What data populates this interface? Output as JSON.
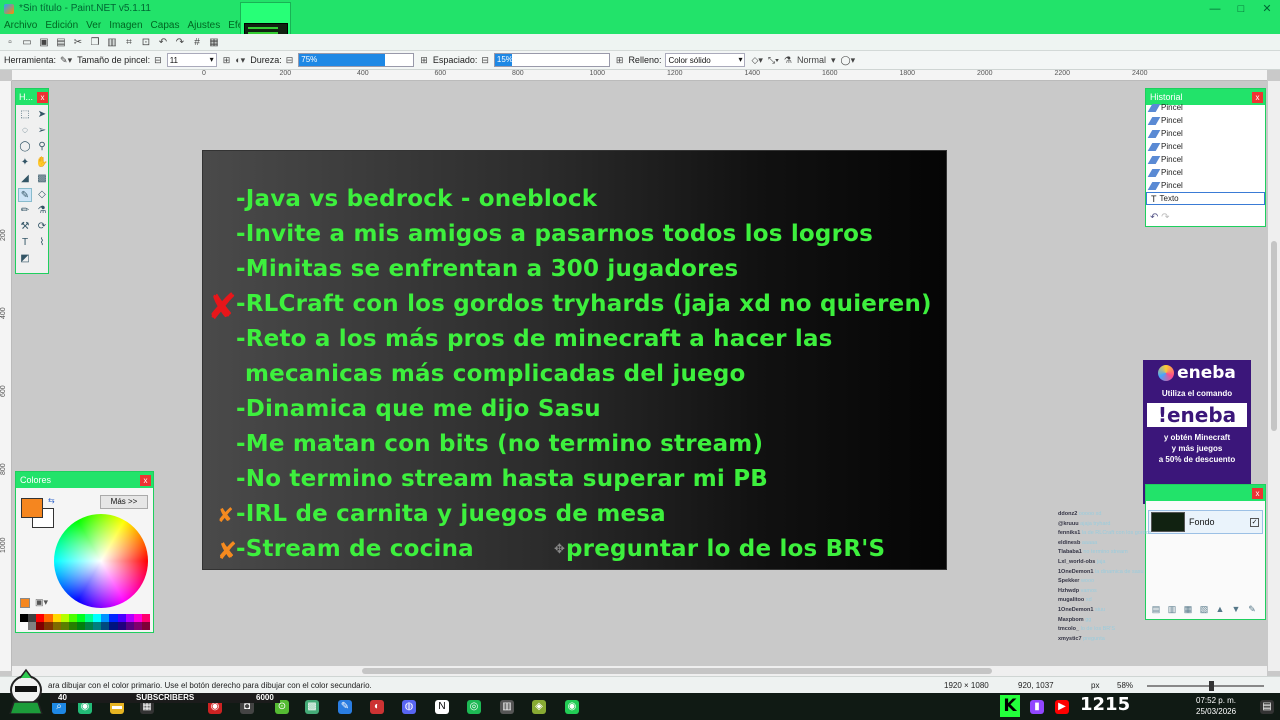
{
  "window": {
    "title": "*Sin título - Paint.NET v5.1.11",
    "controls": [
      "—",
      "□",
      "✕"
    ]
  },
  "menu": {
    "items": [
      "Archivo",
      "Edición",
      "Ver",
      "Imagen",
      "Capas",
      "Ajustes",
      "Efectos"
    ]
  },
  "toolbar": {
    "tool_label": "Herramienta:",
    "brush_size_label": "Tamaño de pincel:",
    "brush_size_value": "11",
    "hardness_label": "Dureza:",
    "hardness_value": "75%",
    "hardness_fraction": 0.75,
    "spacing_label": "Espaciado:",
    "spacing_value": "15%",
    "spacing_fraction": 0.15,
    "fill_label": "Relleno:",
    "fill_value": "Color sólido",
    "blend_mode": "Normal"
  },
  "rulers": {
    "top": [
      "0",
      "200",
      "400",
      "600",
      "800",
      "1000",
      "1200",
      "1400",
      "1600",
      "1800",
      "2000",
      "2200",
      "2400"
    ],
    "left": [
      "200",
      "400",
      "600",
      "800",
      "1000"
    ]
  },
  "canvas": {
    "text_color": "#3df03d",
    "lines": [
      "-Java vs bedrock - oneblock",
      "-Invite a mis amigos a pasarnos todos los logros",
      "-Minitas se enfrentan a 300 jugadores",
      "-RLCraft con los gordos tryhards (jaja xd no quieren)",
      "-Reto a los más pros de minecraft a hacer las",
      "mecanicas más complicadas del juego",
      "-Dinamica que me dijo Sasu",
      "-Me matan con bits (no termino stream)",
      "-No termino stream hasta superar mi PB",
      "-IRL de carnita y juegos de mesa",
      "-Stream de cocina",
      "preguntar lo de los BR'S"
    ]
  },
  "tools_window": {
    "title": "H..."
  },
  "colors_window": {
    "title": "Colores",
    "more_button": "Más >>",
    "primary_color": "#f5861f",
    "secondary_color": "#ffffff"
  },
  "history_window": {
    "title": "Historial",
    "items": [
      "Pincel",
      "Pincel",
      "Pincel",
      "Pincel",
      "Pincel",
      "Pincel",
      "Pincel",
      "Texto"
    ]
  },
  "eneba": {
    "logo": "eneba",
    "line1": "Utiliza el comando",
    "command": "!eneba",
    "line2": "y obtén Minecraft",
    "line3": "y más juegos",
    "line4": "a 50% de descuento"
  },
  "layers_window": {
    "layer_name": "Fondo"
  },
  "chat": {
    "messages": [
      {
        "user": "ddonz2",
        "text": "ooooo xd"
      },
      {
        "user": "@kruuu",
        "text": "ajaja tryhard"
      },
      {
        "user": "fenniks1",
        "text": "la de RLCraft con los gordos"
      },
      {
        "user": "eldinesb",
        "text": "aaaaa"
      },
      {
        "user": "Tlababa1",
        "text": "no termino stream"
      },
      {
        "user": "Lxl_world-obs",
        "text": "jaja"
      },
      {
        "user": "1OneDemon1",
        "text": "la dinamica de sasu"
      },
      {
        "user": "Spekker",
        "text": "wooo"
      },
      {
        "user": "Hzhwdp",
        "text": "vamos"
      },
      {
        "user": "mugalitoo",
        "text": "xd"
      },
      {
        "user": "1OneDemon1",
        "text": "siuu"
      },
      {
        "user": "Maxpbom",
        "text": "gg"
      },
      {
        "user": "tmcolo_",
        "text": "lo de los BR'S"
      },
      {
        "user": "xmystic7",
        "text": "pregunta"
      }
    ]
  },
  "statusbar": {
    "hint": "ara dibujar con el color primario. Use el botón derecho para dibujar con el color secundario.",
    "image_size": "1920 × 1080",
    "cursor_pos": "920, 1037",
    "units": "px",
    "zoom": "58%"
  },
  "stream_overlay": {
    "left_count": "40",
    "subscribers_label": "SUBSCRIBERS",
    "goal": "6000",
    "viewer_count": "1215"
  },
  "taskbar": {
    "time": "07:52 p. m.",
    "date": "25/03/2026"
  }
}
